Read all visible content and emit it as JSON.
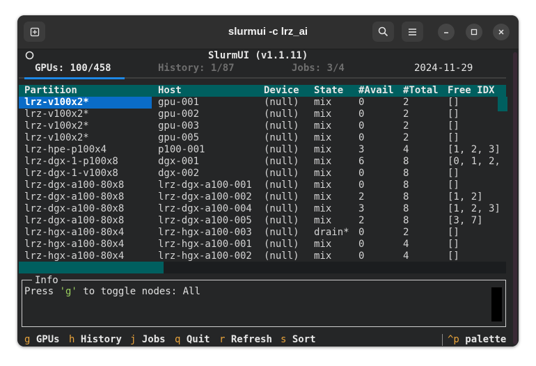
{
  "window": {
    "title": "slurmui -c lrz_ai"
  },
  "app": {
    "title": "SlurmUI (v1.1.11)",
    "tabs": [
      {
        "label": "GPUs: 100/458"
      },
      {
        "label": "History: 1/87"
      },
      {
        "label": "Jobs: 3/4"
      }
    ],
    "date": "2024-11-29"
  },
  "table": {
    "columns": [
      "Partition",
      "Host",
      "Device",
      "State",
      "#Avail",
      "#Total",
      "Free IDX"
    ],
    "rows": [
      [
        "lrz-v100x2*",
        "gpu-001",
        "(null)",
        "mix",
        "0",
        "2",
        "[]"
      ],
      [
        "lrz-v100x2*",
        "gpu-002",
        "(null)",
        "mix",
        "0",
        "2",
        "[]"
      ],
      [
        "lrz-v100x2*",
        "gpu-003",
        "(null)",
        "mix",
        "0",
        "2",
        "[]"
      ],
      [
        "lrz-v100x2*",
        "gpu-005",
        "(null)",
        "mix",
        "0",
        "2",
        "[]"
      ],
      [
        "lrz-hpe-p100x4",
        "p100-001",
        "(null)",
        "mix",
        "3",
        "4",
        "[1, 2, 3]"
      ],
      [
        "lrz-dgx-1-p100x8",
        "dgx-001",
        "(null)",
        "mix",
        "6",
        "8",
        "[0, 1, 2,"
      ],
      [
        "lrz-dgx-1-v100x8",
        "dgx-002",
        "(null)",
        "mix",
        "0",
        "8",
        "[]"
      ],
      [
        "lrz-dgx-a100-80x8",
        "lrz-dgx-a100-001",
        "(null)",
        "mix",
        "0",
        "8",
        "[]"
      ],
      [
        "lrz-dgx-a100-80x8",
        "lrz-dgx-a100-002",
        "(null)",
        "mix",
        "2",
        "8",
        "[1, 2]"
      ],
      [
        "lrz-dgx-a100-80x8",
        "lrz-dgx-a100-004",
        "(null)",
        "mix",
        "3",
        "8",
        "[1, 2, 3]"
      ],
      [
        "lrz-dgx-a100-80x8",
        "lrz-dgx-a100-005",
        "(null)",
        "mix",
        "2",
        "8",
        "[3, 7]"
      ],
      [
        "lrz-hgx-a100-80x4",
        "lrz-hgx-a100-003",
        "(null)",
        "drain*",
        "0",
        "2",
        "[]"
      ],
      [
        "lrz-hgx-a100-80x4",
        "lrz-hgx-a100-001",
        "(null)",
        "mix",
        "0",
        "4",
        "[]"
      ],
      [
        "lrz-hgx-a100-80x4",
        "lrz-hgx-a100-002",
        "(null)",
        "mix",
        "0",
        "4",
        "[]"
      ]
    ]
  },
  "info": {
    "title": "Info",
    "prefix": "Press ",
    "key": "'g'",
    "suffix": " to toggle nodes: All"
  },
  "footer": {
    "items": [
      {
        "key": "g",
        "label": "GPUs"
      },
      {
        "key": "h",
        "label": "History"
      },
      {
        "key": "j",
        "label": "Jobs"
      },
      {
        "key": "q",
        "label": "Quit"
      },
      {
        "key": "r",
        "label": "Refresh"
      },
      {
        "key": "s",
        "label": "Sort"
      }
    ],
    "palette": {
      "key": "^p",
      "label": "palette"
    }
  },
  "colors": {
    "accent": "#005f5f",
    "selection": "#0a6cc8",
    "tab_underline": "#1e88e5",
    "key_highlight": "#e8a33b",
    "info_key": "#9bd15f"
  }
}
